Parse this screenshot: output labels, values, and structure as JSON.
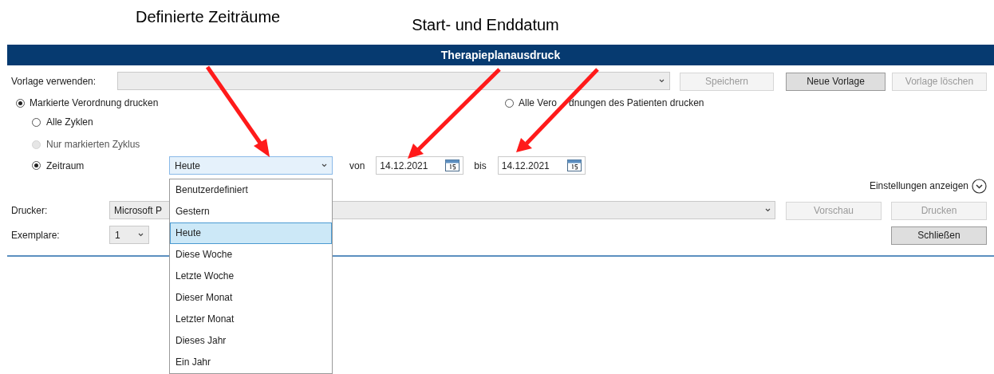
{
  "annotations": [
    {
      "text": "Definierte Zeiträume"
    },
    {
      "text": "Start- und Enddatum"
    }
  ],
  "window": {
    "title": "Therapieplanausdruck"
  },
  "template": {
    "label": "Vorlage verwenden:",
    "buttons": [
      {
        "label": "Speichern",
        "disabled": true
      },
      {
        "label": "Neue Vorlage",
        "disabled": false
      },
      {
        "label": "Vorlage löschen",
        "disabled": true
      }
    ]
  },
  "scope": [
    {
      "label": "Markierte Verordnung drucken",
      "selected": true
    },
    {
      "label_parts": [
        "Alle Vero",
        "dnungen des Patienten drucken"
      ],
      "selected": false
    }
  ],
  "cycles": [
    {
      "label": "Alle Zyklen",
      "selected": false,
      "disabled": false
    },
    {
      "label": "Nur markierten Zyklus",
      "selected": false,
      "disabled": true
    },
    {
      "label": "Zeitraum",
      "selected": true,
      "disabled": false
    }
  ],
  "period": {
    "value": "Heute",
    "expanded": true,
    "options": [
      {
        "label": "Benutzerdefiniert",
        "selected": false
      },
      {
        "label": "Gestern",
        "selected": false
      },
      {
        "label": "Heute",
        "selected": true
      },
      {
        "label": "Diese Woche",
        "selected": false
      },
      {
        "label": "Letzte Woche",
        "selected": false
      },
      {
        "label": "Dieser Monat",
        "selected": false
      },
      {
        "label": "Letzter Monat",
        "selected": false
      },
      {
        "label": "Dieses Jahr",
        "selected": false
      },
      {
        "label": "Ein Jahr",
        "selected": false
      }
    ],
    "from_label": "von",
    "from": "14.12.2021",
    "to_label": "bis",
    "to": "14.12.2021"
  },
  "settings_link": "Einstellungen anzeigen",
  "printer": {
    "label": "Drucker:",
    "value": "Microsoft P",
    "buttons": [
      {
        "label": "Vorschau",
        "disabled": true
      },
      {
        "label": "Drucken",
        "disabled": true
      }
    ]
  },
  "copies": {
    "label": "Exemplare:",
    "value": "1"
  },
  "close_button": "Schließen"
}
